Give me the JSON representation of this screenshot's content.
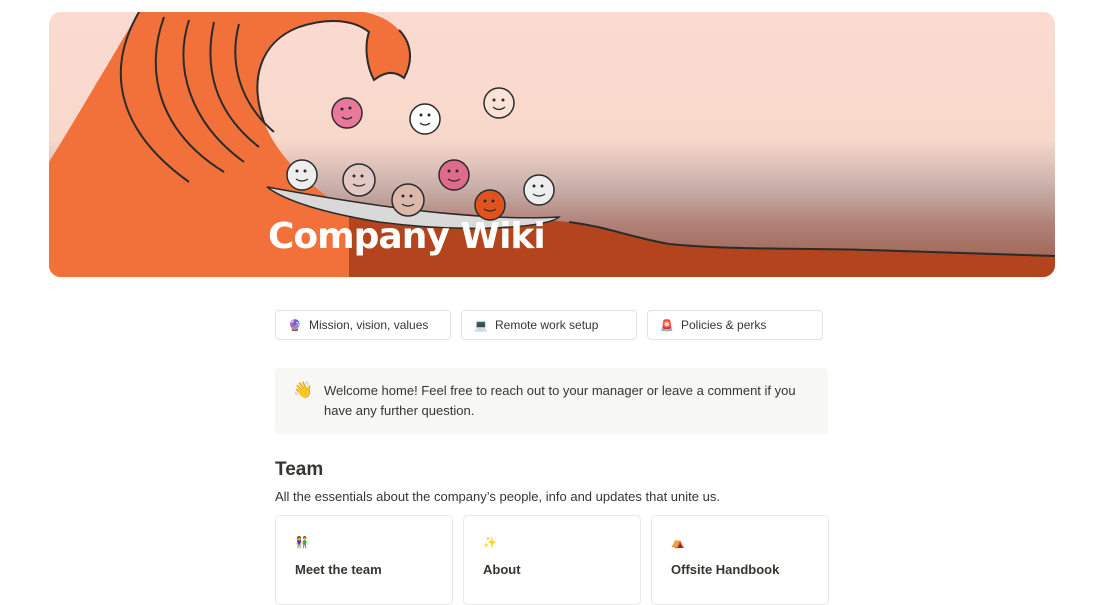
{
  "hero": {
    "title": "Company Wiki"
  },
  "quick_links": [
    {
      "icon": "crystal-ball-icon",
      "glyph": "🔮",
      "label": "Mission, vision, values"
    },
    {
      "icon": "laptop-icon",
      "glyph": "💻",
      "label": "Remote work setup"
    },
    {
      "icon": "siren-icon",
      "glyph": "🚨",
      "label": "Policies & perks"
    }
  ],
  "callout": {
    "icon": "waving-hand-icon",
    "glyph": "👋",
    "text": "Welcome home! Feel free to reach out to your manager or leave a comment if you have any further question."
  },
  "team": {
    "heading": "Team",
    "subtitle": "All the essentials about the company’s people, info and updates that unite us.",
    "cards": [
      {
        "icon": "people-icon",
        "glyph": "👫",
        "title": "Meet the team"
      },
      {
        "icon": "sparkles-icon",
        "glyph": "✨",
        "title": "About"
      },
      {
        "icon": "tent-icon",
        "glyph": "⛺",
        "title": "Offsite Handbook"
      }
    ]
  },
  "colors": {
    "wave": "#f2713b",
    "hero_bg": "#fbdbd0",
    "text": "#37352f"
  }
}
